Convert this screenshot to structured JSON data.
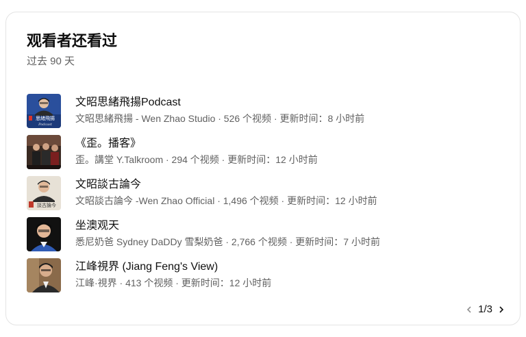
{
  "card": {
    "title": "观看者还看过",
    "subtitle": "过去 90 天"
  },
  "channels": [
    {
      "title": "文昭思緒飛揚Podcast",
      "meta": "文昭思緒飛揚 - Wen Zhao Studio · 526 个视频 · 更新时间：8 小时前",
      "thumb_text": "思緒飛揚",
      "thumb_subtext": "Podcast"
    },
    {
      "title": "《歪。播客》",
      "meta": "歪。講堂 Y.Talkroom · 294 个视频 · 更新时间：12 小时前"
    },
    {
      "title": "文昭談古論今",
      "meta": "文昭談古論今 -Wen Zhao Official · 1,496 个视频 · 更新时间：12 小时前",
      "thumb_text": "談古論今"
    },
    {
      "title": "坐澳观天",
      "meta": "悉尼奶爸 Sydney DaDDy 雪梨奶爸 · 2,766 个视频 · 更新时间：7 小时前"
    },
    {
      "title": "江峰視界 (Jiang Feng's View)",
      "meta": "江峰·視界 · 413 个视频 · 更新时间：12 小时前"
    }
  ],
  "pager": {
    "label": "1/3",
    "prev_icon": "chevron-left-icon",
    "next_icon": "chevron-right-icon"
  }
}
